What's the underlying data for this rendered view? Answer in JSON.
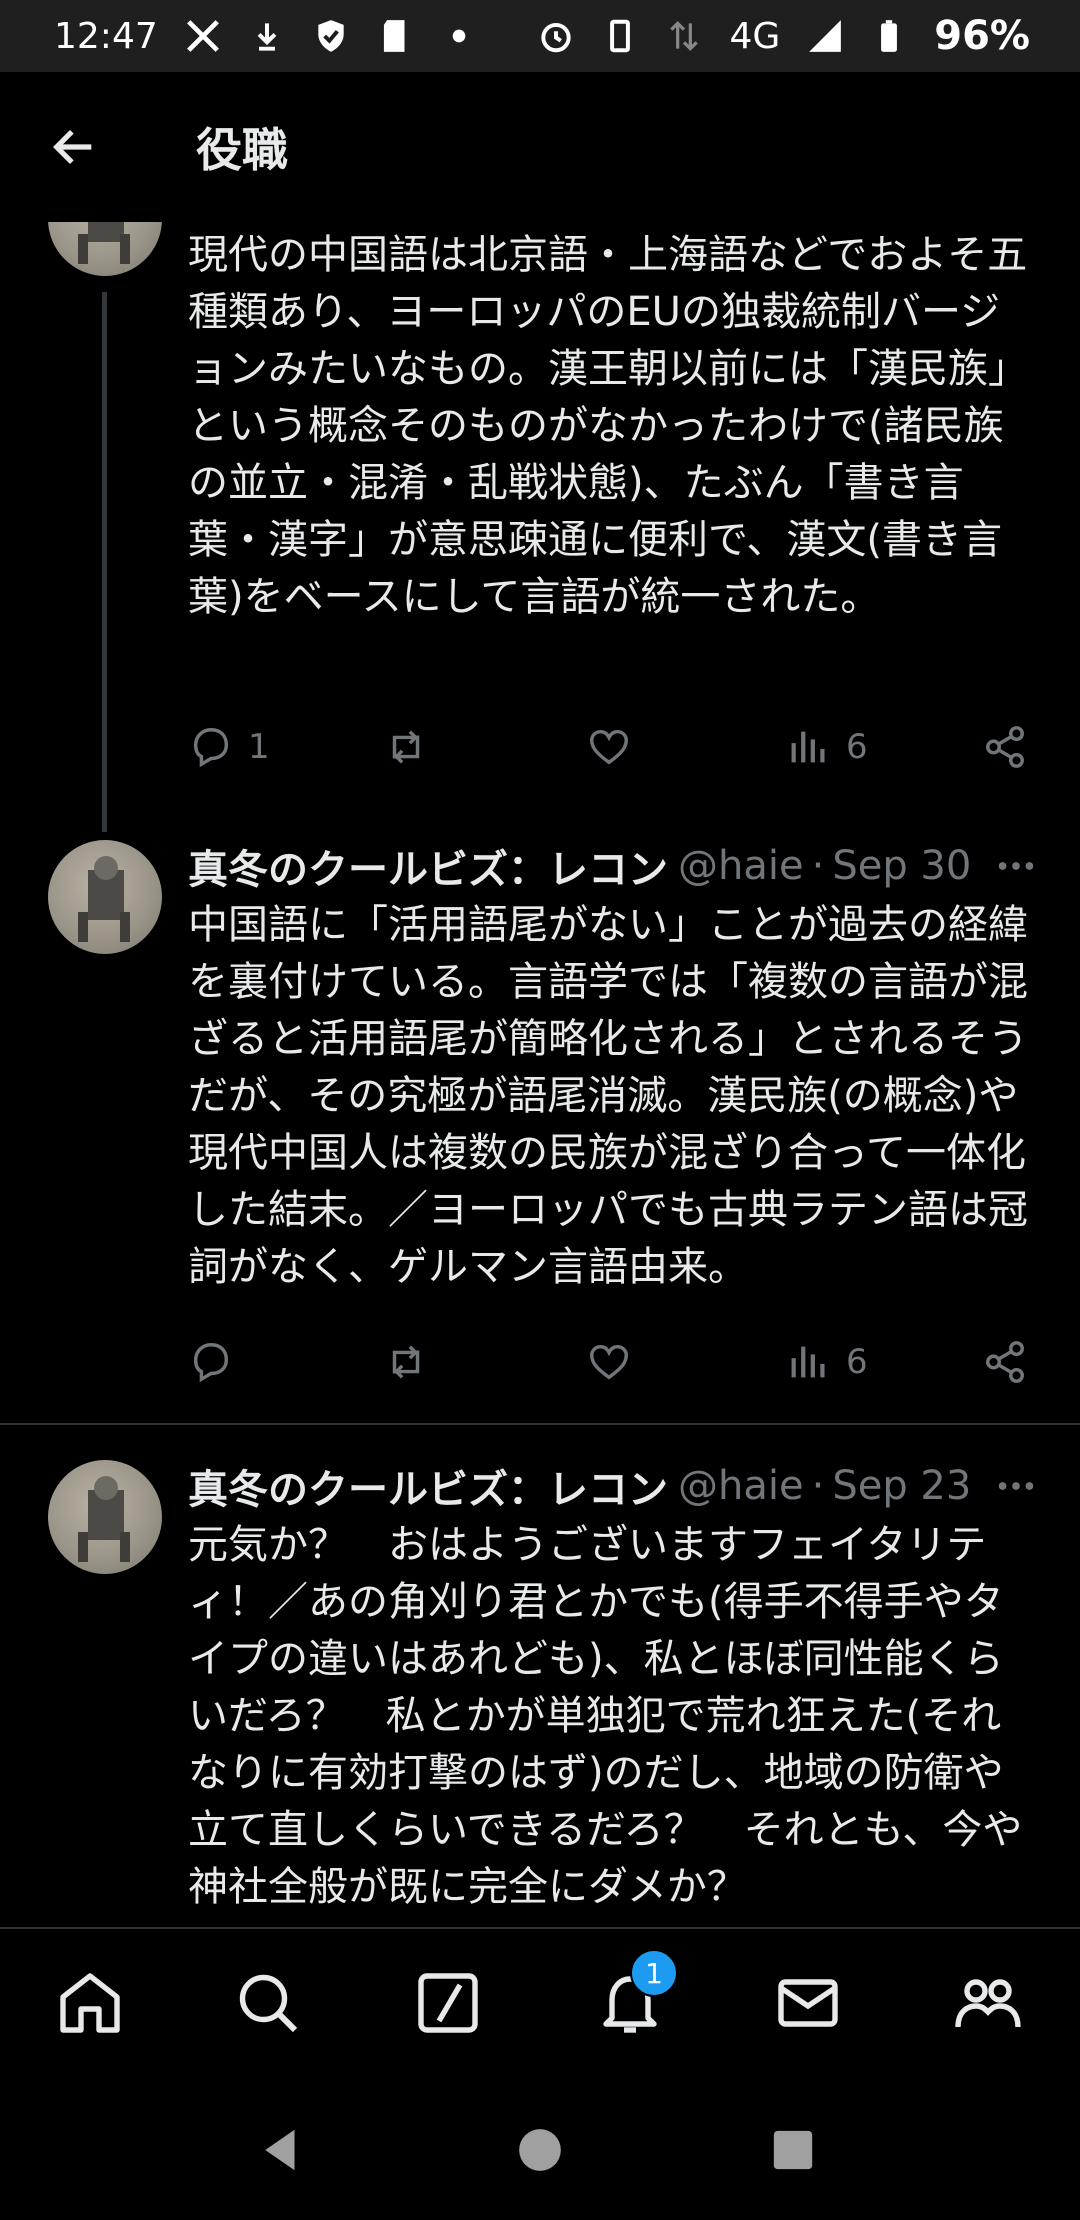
{
  "status_bar": {
    "time": "12:47",
    "network": "4G",
    "battery": "96%",
    "icons": [
      "x-logo-icon",
      "download-icon",
      "shield-icon",
      "sd-card-icon",
      "dot-icon",
      "alarm-icon",
      "vibrate-icon",
      "data-arrows-icon",
      "signal-icon",
      "battery-icon"
    ]
  },
  "header": {
    "title": "役職",
    "back_icon": "arrow-left-icon"
  },
  "tweets": [
    {
      "text": "現代の中国語は北京語・上海語などでおよそ五種類あり、ヨーロッパのEUの独裁統制バージョンみたいなもの。漢王朝以前には「漢民族」という概念そのものがなかったわけで(諸民族の並立・混淆・乱戦状態)、たぶん「書き言葉・漢字」が意思疎通に便利で、漢文(書き言葉)をベースにして言語が統一された。",
      "replies": "1",
      "views": "6"
    },
    {
      "author": "真冬のクールビズ：レコン",
      "handle": "@haie",
      "date": "Sep 30",
      "text": "中国語に「活用語尾がない」ことが過去の経緯を裏付けている。言語学では「複数の言語が混ざると活用語尾が簡略化される」とされるそうだが、その究極が語尾消滅。漢民族(の概念)や現代中国人は複数の民族が混ざり合って一体化した結末。／ヨーロッパでも古典ラテン語は冠詞がなく、ゲルマン言語由来。",
      "views": "6"
    },
    {
      "author": "真冬のクールビズ：レコン",
      "handle": "@haie",
      "date": "Sep 23",
      "text": "元気か？　おはようございますフェイタリティ！／あの角刈り君とかでも(得手不得手やタイプの違いはあれども)、私とほぼ同性能くらいだろ？　私とかが単独犯で荒れ狂えた(それなりに有効打撃のはず)のだし、地域の防衛や立て直しくらいできるだろ？　それとも、今や神社全般が既に完全にダメか？"
    }
  ],
  "bottom_nav": {
    "items": [
      "home-icon",
      "search-icon",
      "grok-icon",
      "notifications-icon",
      "messages-icon",
      "communities-icon"
    ],
    "notification_badge": "1"
  },
  "system_nav": [
    "back-triangle-icon",
    "home-circle-icon",
    "recents-square-icon"
  ],
  "colors": {
    "background": "#000000",
    "text": "#e7e9ea",
    "muted": "#71767b",
    "accent": "#1d9bf0"
  }
}
